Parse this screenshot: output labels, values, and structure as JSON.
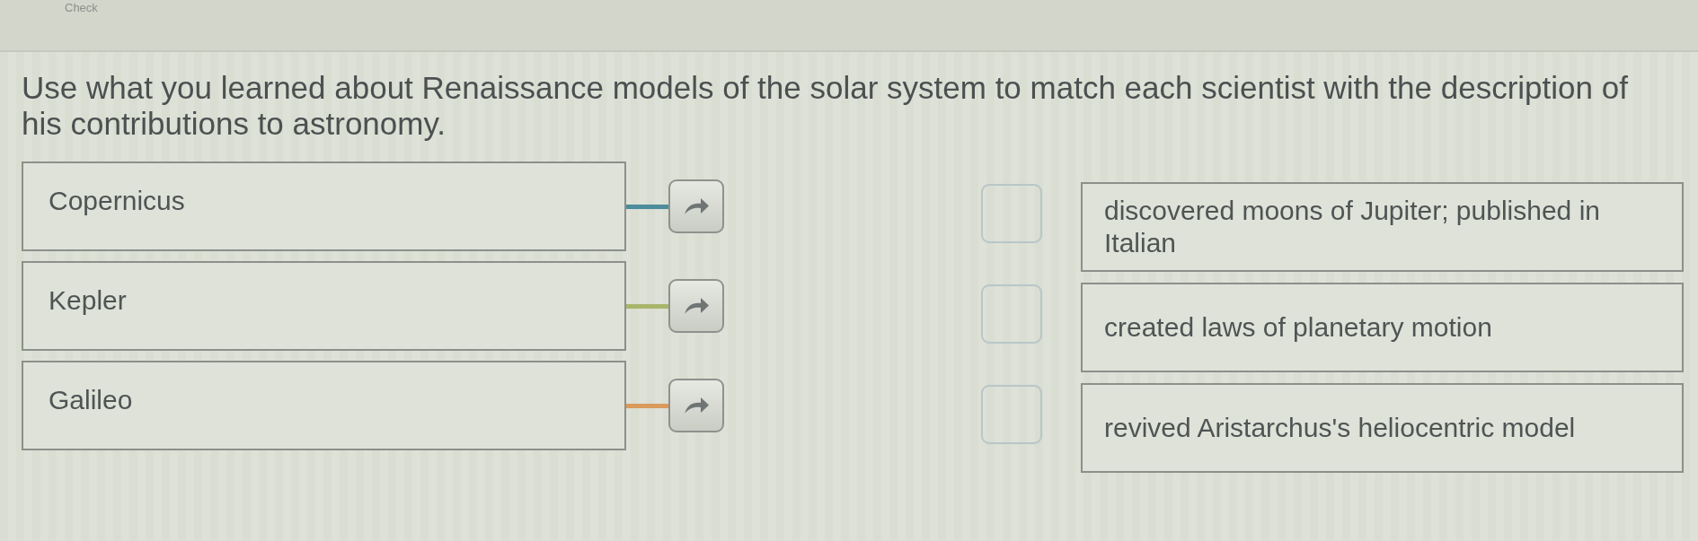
{
  "header": {
    "check_label": "Check"
  },
  "instructions": "Use what you learned about Renaissance models of the solar system to match each scientist with the description of his contributions to astronomy.",
  "scientists": [
    {
      "name": "Copernicus",
      "color": "#4d8c9c"
    },
    {
      "name": "Kepler",
      "color": "#a9b56a"
    },
    {
      "name": "Galileo",
      "color": "#d99a5c"
    }
  ],
  "descriptions": [
    {
      "text": "discovered moons of Jupiter; published in Italian"
    },
    {
      "text": "created laws of planetary motion"
    },
    {
      "text": "revived Aristarchus's heliocentric model"
    }
  ]
}
